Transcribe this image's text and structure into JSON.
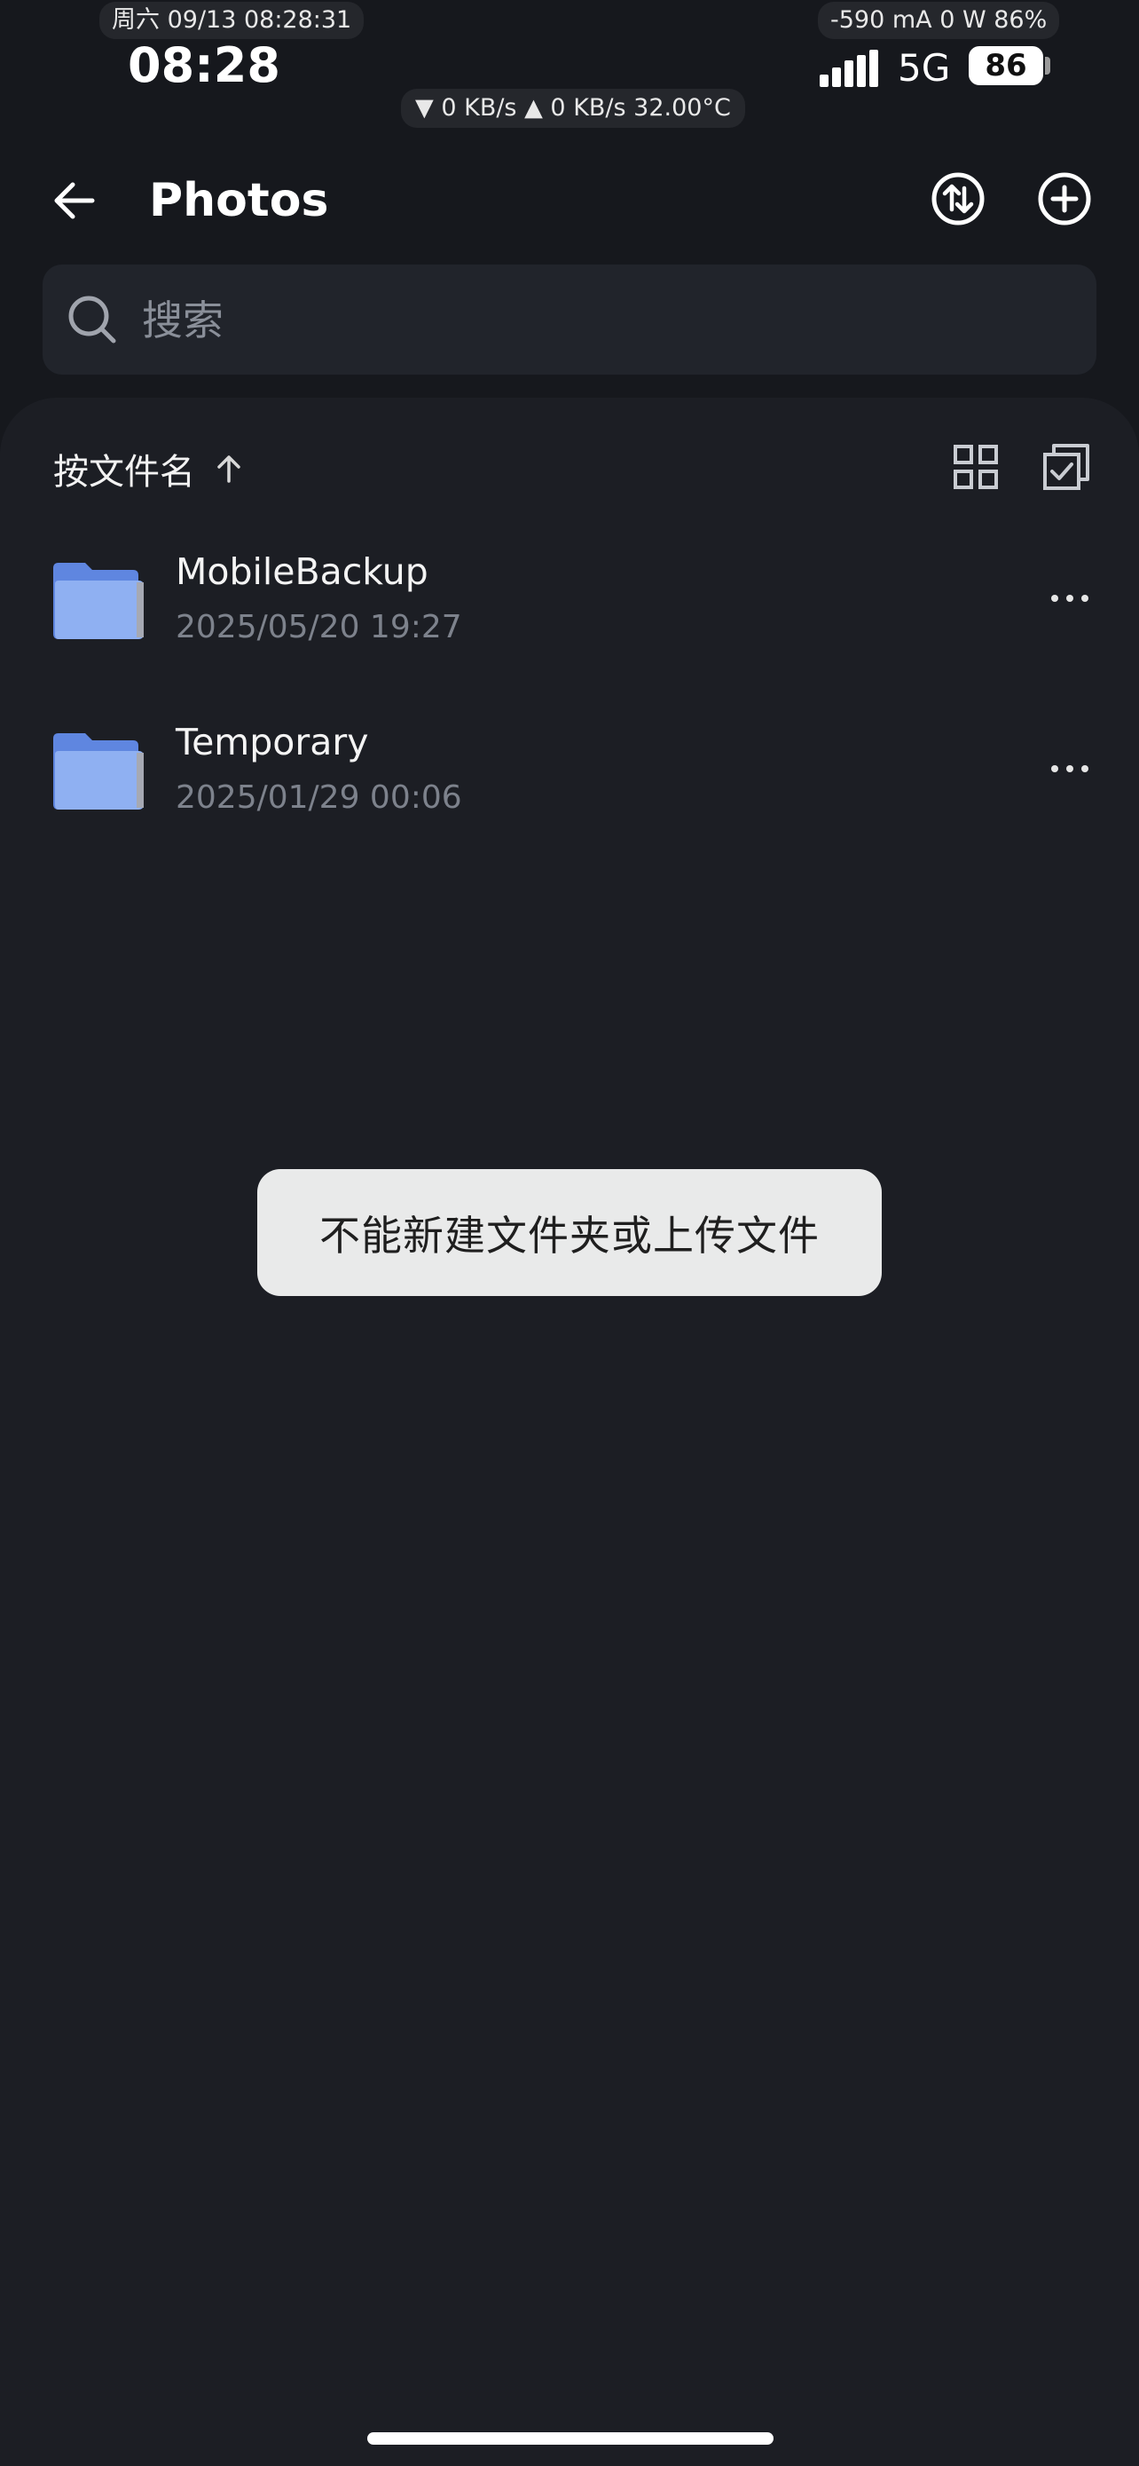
{
  "status_bar": {
    "date_time": "周六 09/13 08:28:31",
    "clock": "08:28",
    "network_speed": "▼ 0 KB/s ▲ 0 KB/s 32.00°C",
    "power_info": "-590 mA 0 W 86%",
    "network_type": "5G",
    "battery_level": "86"
  },
  "toolbar": {
    "back_icon": "arrow-left-icon",
    "title": "Photos",
    "transfer_icon": "transfer-icon",
    "add_icon": "plus-circle-icon"
  },
  "search": {
    "placeholder": "搜索",
    "value": ""
  },
  "sort": {
    "label": "按文件名",
    "direction_icon": "arrow-up-icon",
    "grid_icon": "grid-view-icon",
    "select_icon": "multi-select-icon"
  },
  "files": [
    {
      "name": "MobileBackup",
      "date": "2025/05/20 19:27",
      "icon": "folder-icon"
    },
    {
      "name": "Temporary",
      "date": "2025/01/29 00:06",
      "icon": "folder-icon"
    }
  ],
  "toast": {
    "message": "不能新建文件夹或上传文件"
  },
  "colors": {
    "background": "#16181d",
    "sheet": "#1c1e24",
    "folder": "#7b9ee8",
    "toast_bg": "#e9eaea"
  }
}
